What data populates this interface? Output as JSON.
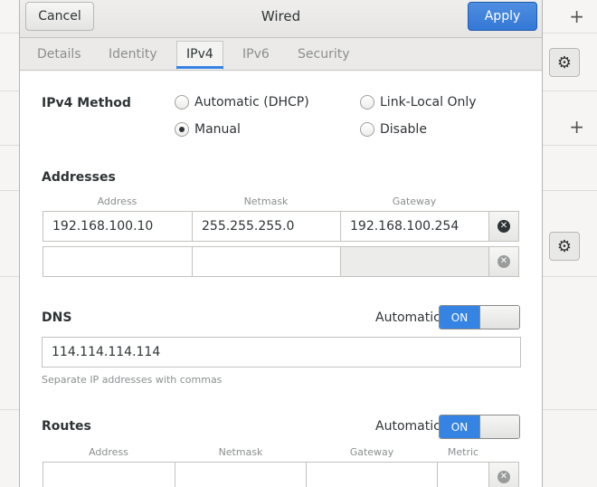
{
  "dialog": {
    "title": "Wired",
    "cancel_label": "Cancel",
    "apply_label": "Apply"
  },
  "tabs": [
    {
      "label": "Details"
    },
    {
      "label": "Identity"
    },
    {
      "label": "IPv4",
      "active": true
    },
    {
      "label": "IPv6"
    },
    {
      "label": "Security"
    }
  ],
  "ipv4": {
    "method_label": "IPv4 Method",
    "methods": [
      {
        "label": "Automatic (DHCP)",
        "checked": false
      },
      {
        "label": "Link-Local Only",
        "checked": false
      },
      {
        "label": "Manual",
        "checked": true
      },
      {
        "label": "Disable",
        "checked": false
      }
    ],
    "addresses": {
      "title": "Addresses",
      "headers": [
        "Address",
        "Netmask",
        "Gateway"
      ],
      "rows": [
        {
          "address": "192.168.100.10",
          "netmask": "255.255.255.0",
          "gateway": "192.168.100.254"
        },
        {
          "address": "",
          "netmask": "",
          "gateway": ""
        }
      ]
    },
    "dns": {
      "title": "DNS",
      "automatic_label": "Automatic",
      "switch_label": "ON",
      "value": "114.114.114.114",
      "hint": "Separate IP addresses with commas"
    },
    "routes": {
      "title": "Routes",
      "automatic_label": "Automatic",
      "switch_label": "ON",
      "headers": [
        "Address",
        "Netmask",
        "Gateway",
        "Metric"
      ]
    }
  },
  "background": {
    "plus_icon": "+",
    "gear_icon": "⚙"
  }
}
